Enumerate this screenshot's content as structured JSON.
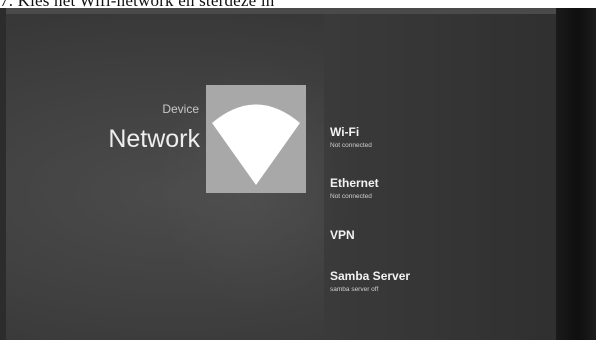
{
  "document": {
    "caption": "7.   Kies het Wifi-network en sterdeze in"
  },
  "header": {
    "section_label": "Device",
    "page_title": "Network"
  },
  "hero": {
    "icon": "wifi-icon"
  },
  "menu": {
    "items": [
      {
        "title": "Wi-Fi",
        "subtitle": "Not connected"
      },
      {
        "title": "Ethernet",
        "subtitle": "Not connected"
      },
      {
        "title": "VPN",
        "subtitle": ""
      },
      {
        "title": "Samba Server",
        "subtitle": "samba server off"
      }
    ]
  },
  "colors": {
    "screen_bg": "#404040",
    "panel_bg": "#353535",
    "icon_tile_bg": "#a8a8a8",
    "icon_fg": "#ffffff",
    "text_primary": "#f2f2f2"
  }
}
